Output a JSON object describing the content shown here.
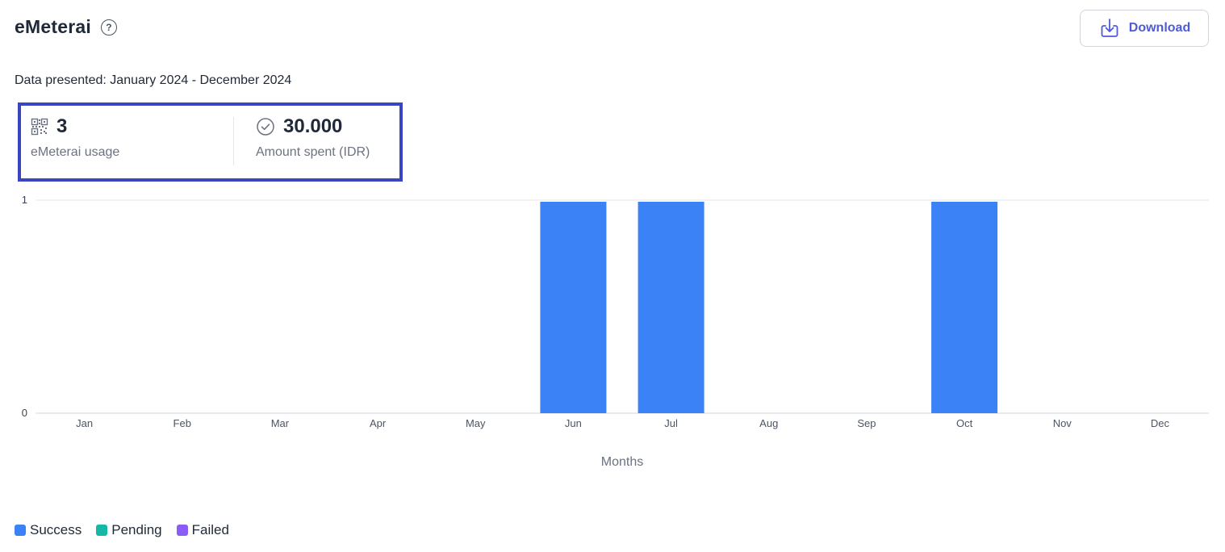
{
  "header": {
    "title": "eMeterai",
    "help_symbol": "?"
  },
  "download": {
    "label": "Download"
  },
  "subtitle": "Data presented: January 2024 - December 2024",
  "stats": {
    "usage": {
      "value": "3",
      "label": "eMeterai usage",
      "icon": "qr-code-icon"
    },
    "amount": {
      "value": "30.000",
      "label": "Amount spent (IDR)",
      "icon": "check-circle-icon"
    }
  },
  "colors": {
    "accent": "#4f5bd5",
    "highlight_border": "#3b45c4",
    "success": "#3b82f6",
    "pending": "#14b8a6",
    "failed": "#8b5cf6"
  },
  "chart_data": {
    "type": "bar",
    "categories": [
      "Jan",
      "Feb",
      "Mar",
      "Apr",
      "May",
      "Jun",
      "Jul",
      "Aug",
      "Sep",
      "Oct",
      "Nov",
      "Dec"
    ],
    "series": [
      {
        "name": "Success",
        "values": [
          0,
          0,
          0,
          0,
          0,
          1,
          1,
          0,
          0,
          1,
          0,
          0
        ],
        "color": "#3b82f6"
      },
      {
        "name": "Pending",
        "values": [
          0,
          0,
          0,
          0,
          0,
          0,
          0,
          0,
          0,
          0,
          0,
          0
        ],
        "color": "#14b8a6"
      },
      {
        "name": "Failed",
        "values": [
          0,
          0,
          0,
          0,
          0,
          0,
          0,
          0,
          0,
          0,
          0,
          0
        ],
        "color": "#8b5cf6"
      }
    ],
    "title": "",
    "xlabel": "Months",
    "ylabel": "",
    "ylim": [
      0,
      1
    ],
    "yticks": [
      0,
      1
    ],
    "stacked": true,
    "grid": true,
    "legend": "bottom-left"
  }
}
